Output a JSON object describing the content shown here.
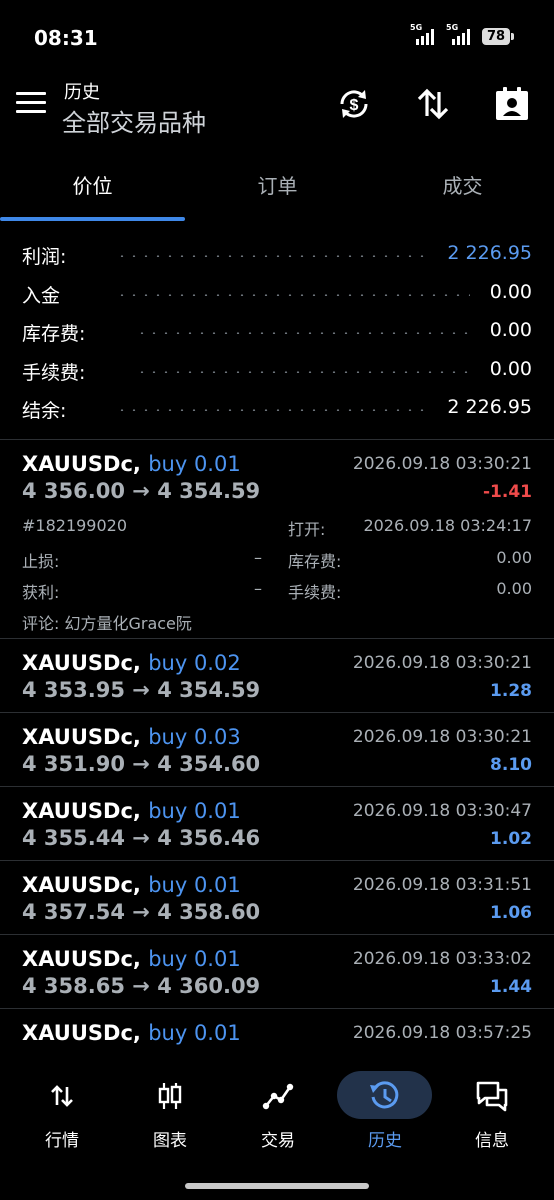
{
  "status_bar": {
    "time": "08:31",
    "signal1_label": "5G",
    "signal2_label": "5G",
    "battery": "78"
  },
  "header": {
    "title": "历史",
    "subtitle": "全部交易品种"
  },
  "tabs": [
    {
      "label": "价位",
      "active": true
    },
    {
      "label": "订单",
      "active": false
    },
    {
      "label": "成交",
      "active": false
    }
  ],
  "summary": [
    {
      "label": "利润:",
      "value": "2 226.95",
      "highlight": true
    },
    {
      "label": "入金",
      "value": "0.00",
      "highlight": false
    },
    {
      "label": "库存费:",
      "value": "0.00",
      "highlight": false
    },
    {
      "label": "手续费:",
      "value": "0.00",
      "highlight": false
    },
    {
      "label": "结余:",
      "value": "2 226.95",
      "highlight": false
    }
  ],
  "trades": [
    {
      "symbol": "XAUUSDc,",
      "side": "buy 0.01",
      "time": "2026.09.18 03:30:21",
      "open_price": "4 356.00",
      "close_price": "4 354.59",
      "profit": "-1.41",
      "profit_sign": "neg",
      "details": {
        "ticket": "#182199020",
        "open_label": "打开:",
        "open_time": "2026.09.18 03:24:17",
        "sl_label": "止损:",
        "sl_value": "–",
        "swap_label": "库存费:",
        "swap_value": "0.00",
        "tp_label": "获利:",
        "tp_value": "–",
        "commission_label": "手续费:",
        "commission_value": "0.00",
        "comment": "评论: 幻方量化Grace阮"
      }
    },
    {
      "symbol": "XAUUSDc,",
      "side": "buy 0.02",
      "time": "2026.09.18 03:30:21",
      "open_price": "4 353.95",
      "close_price": "4 354.59",
      "profit": "1.28",
      "profit_sign": "pos"
    },
    {
      "symbol": "XAUUSDc,",
      "side": "buy 0.03",
      "time": "2026.09.18 03:30:21",
      "open_price": "4 351.90",
      "close_price": "4 354.60",
      "profit": "8.10",
      "profit_sign": "pos"
    },
    {
      "symbol": "XAUUSDc,",
      "side": "buy 0.01",
      "time": "2026.09.18 03:30:47",
      "open_price": "4 355.44",
      "close_price": "4 356.46",
      "profit": "1.02",
      "profit_sign": "pos"
    },
    {
      "symbol": "XAUUSDc,",
      "side": "buy 0.01",
      "time": "2026.09.18 03:31:51",
      "open_price": "4 357.54",
      "close_price": "4 358.60",
      "profit": "1.06",
      "profit_sign": "pos"
    },
    {
      "symbol": "XAUUSDc,",
      "side": "buy 0.01",
      "time": "2026.09.18 03:33:02",
      "open_price": "4 358.65",
      "close_price": "4 360.09",
      "profit": "1.44",
      "profit_sign": "pos"
    },
    {
      "symbol": "XAUUSDc,",
      "side": "buy 0.01",
      "time": "2026.09.18 03:57:25",
      "open_price": "",
      "close_price": "",
      "profit": "",
      "profit_sign": "pos"
    }
  ],
  "arrow": "→",
  "bottom_nav": [
    {
      "label": "行情",
      "icon": "arrows-updown-icon",
      "active": false
    },
    {
      "label": "图表",
      "icon": "candlestick-icon",
      "active": false
    },
    {
      "label": "交易",
      "icon": "trend-line-icon",
      "active": false
    },
    {
      "label": "历史",
      "icon": "history-clock-icon",
      "active": true
    },
    {
      "label": "信息",
      "icon": "chat-bubbles-icon",
      "active": false
    }
  ],
  "colors": {
    "accent": "#3f88e8",
    "profit_positive": "#5b9bf0",
    "profit_negative": "#ef4b4b",
    "background": "#000000"
  }
}
